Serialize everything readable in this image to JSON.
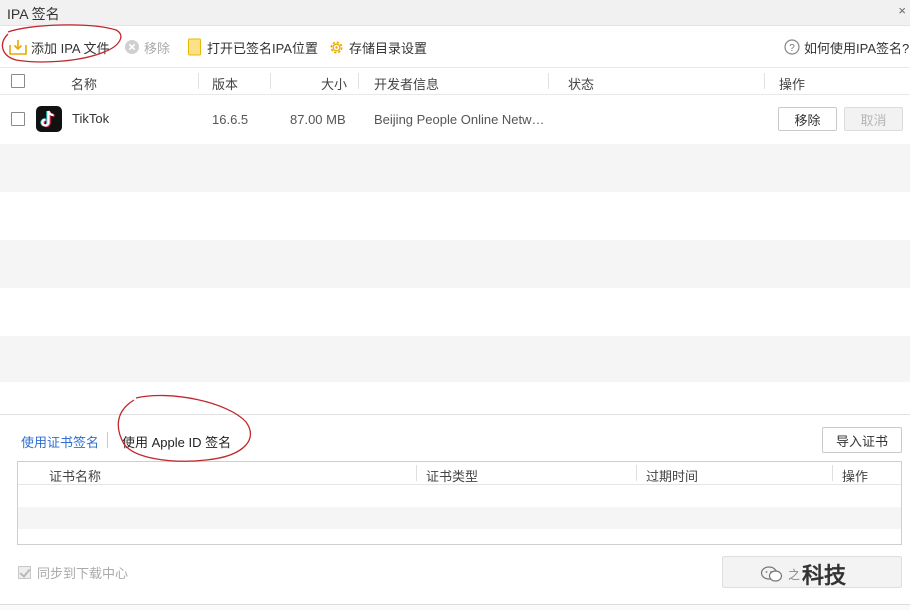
{
  "window": {
    "title": "IPA 签名",
    "close_glyph": "×"
  },
  "toolbar": {
    "add_label": "添加 IPA 文件",
    "remove_label": "移除",
    "open_label": "打开已签名IPA位置",
    "settings_label": "存储目录设置",
    "help_label": "如何使用IPA签名?"
  },
  "list": {
    "headers": {
      "name": "名称",
      "version": "版本",
      "size": "大小",
      "developer": "开发者信息",
      "status": "状态",
      "action": "操作"
    },
    "rows": [
      {
        "name": "TikTok",
        "version": "16.6.5",
        "size": "87.00 MB",
        "developer": "Beijing People Online Netw…",
        "status": "",
        "remove_label": "移除",
        "cancel_label": "取消"
      }
    ]
  },
  "signing": {
    "tab_cert": "使用证书签名",
    "tab_appleid": "使用 Apple ID 签名",
    "import_label": "导入证书",
    "table_headers": {
      "name": "证书名称",
      "type": "证书类型",
      "expiry": "过期时间",
      "action": "操作"
    }
  },
  "footer": {
    "sync_label": "同步到下载中心",
    "sync_checked": true
  },
  "watermark": {
    "small": "之",
    "big": "科技"
  },
  "colors": {
    "accent": "#2f6fd0",
    "annotation": "#c0282d",
    "toolbar_icon": "#f0b400"
  }
}
